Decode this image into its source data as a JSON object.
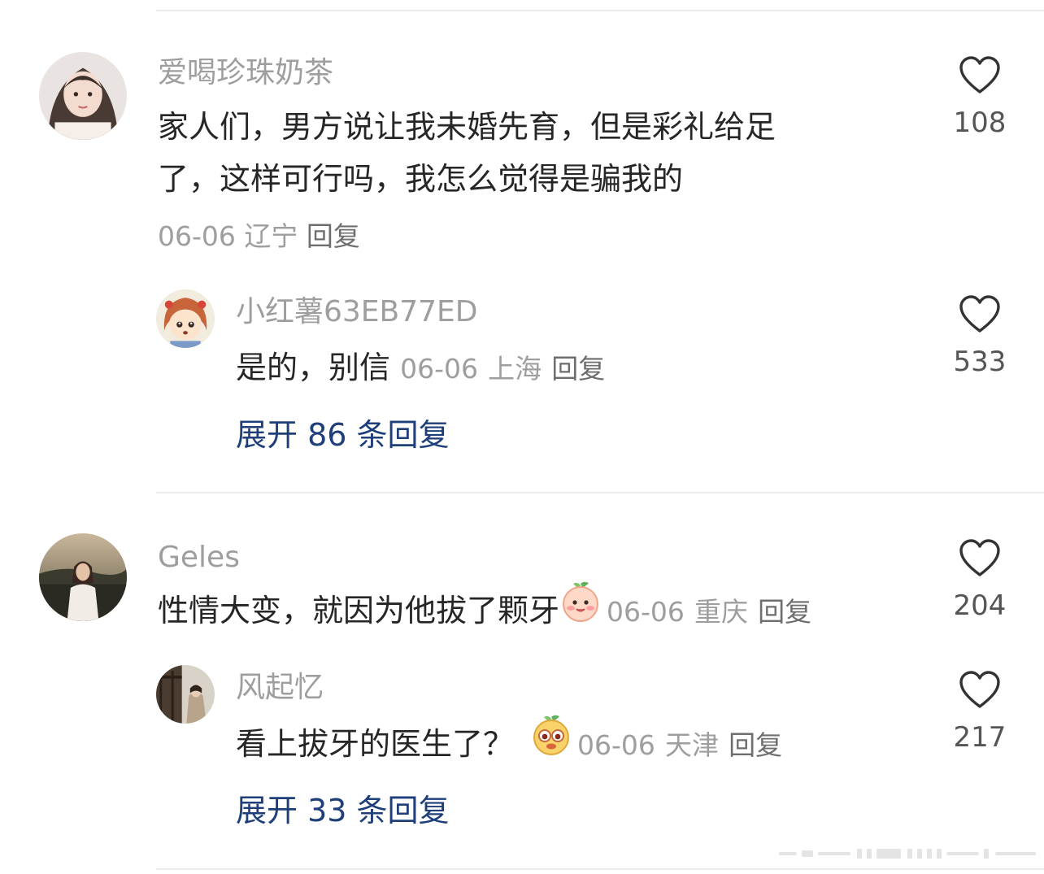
{
  "comments": [
    {
      "username": "爱喝珍珠奶茶",
      "text_line1": "家人们，男方说让我未婚先育，但是彩礼给足",
      "text_line2": "了，这样可行吗，我怎么觉得是骗我的",
      "date": "06-06",
      "location": "辽宁",
      "reply_label": "回复",
      "likes": "108",
      "reply": {
        "username": "小红薯63EB77ED",
        "text": "是的，别信",
        "date": "06-06",
        "location": "上海",
        "reply_label": "回复",
        "likes": "533"
      },
      "expand_label": "展开 86 条回复"
    },
    {
      "username": "Geles",
      "text": "性情大变，就因为他拔了颗牙",
      "emoji": "blush-face-emoji",
      "date": "06-06",
      "location": "重庆",
      "reply_label": "回复",
      "likes": "204",
      "reply": {
        "username": "风起忆",
        "text": "看上拔牙的医生了？",
        "emoji": "funny-face-emoji",
        "date": "06-06",
        "location": "天津",
        "reply_label": "回复",
        "likes": "217"
      },
      "expand_label": "展开 33 条回复"
    }
  ],
  "colors": {
    "username": "#9e9e9e",
    "text": "#262626",
    "expand": "#1e3f7a",
    "divider": "#ececec"
  },
  "icons": {
    "like": "heart-outline-icon"
  }
}
